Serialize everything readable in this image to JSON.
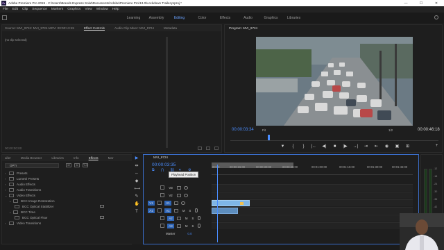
{
  "window": {
    "title": "Adobe Premiere Pro 2019 - C:\\Users\\Brands Express Solut\\Documents\\Adobe\\Premiere Pro\\13.0\\Lockdown Trailer.prproj *",
    "minimize": "—",
    "maximize": "☐",
    "close": "✕",
    "logo": "Pr"
  },
  "menu": [
    "File",
    "Edit",
    "Clip",
    "Sequence",
    "Markers",
    "Graphics",
    "View",
    "Window",
    "Help"
  ],
  "workspaces": {
    "tabs": [
      "Learning",
      "Assembly",
      "Editing",
      "Color",
      "Effects",
      "Audio",
      "Graphics",
      "Libraries"
    ],
    "active": "Editing"
  },
  "source_panel": {
    "tabs": [
      "Source: MVI_9724: MVI_9724.MOV: 00:00:13:45",
      "Effect Controls",
      "Audio Clip Mixer: MVI_9724",
      "Metadata"
    ],
    "active_tab": "Effect Controls",
    "no_clip": "(no clip selected)",
    "timecode": "00:00:00:00"
  },
  "program_monitor": {
    "title": "Program: MVI_9724",
    "timecode_current": "00:00:03:34",
    "fit": "Fit",
    "resolution": "1/2",
    "timecode_duration": "00:00:46:18",
    "transport": [
      "▼",
      "{",
      "}",
      "|←",
      "◀|",
      "■",
      "|▶",
      "→|",
      "⇥",
      "⇤",
      "◉",
      "▣",
      "⊞"
    ],
    "add": "+"
  },
  "project_panel": {
    "tabs": [
      "aller",
      "Media Browser",
      "Libraries",
      "Info",
      "Effects",
      "Mar"
    ],
    "active_tab": "Effects",
    "search_value": "OPTI",
    "tools": [
      "32",
      "32",
      "YUV"
    ],
    "tree": [
      {
        "label": "Presets",
        "indent": 0
      },
      {
        "label": "Lumetri Presets",
        "indent": 0
      },
      {
        "label": "Audio Effects",
        "indent": 0
      },
      {
        "label": "Audio Transitions",
        "indent": 0
      },
      {
        "label": "Video Effects",
        "indent": 0,
        "open": true
      },
      {
        "label": "BCC Image Restoration",
        "indent": 1,
        "open": true
      },
      {
        "label": "BCC Optical Stabilizer",
        "indent": 2,
        "effect": true
      },
      {
        "label": "BCC Time",
        "indent": 1,
        "open": true
      },
      {
        "label": "BCC Optical Flow",
        "indent": 2,
        "effect": true
      },
      {
        "label": "Video Transitions",
        "indent": 0
      }
    ]
  },
  "tools": [
    "▶",
    "⇹",
    "⇔",
    "◆",
    "⟷",
    "✎",
    "✋",
    "T"
  ],
  "timeline": {
    "title": "MVI_9724",
    "timecode": "00:00:03:35",
    "tooltip": "Playhead Position",
    "ruler_labels": [
      "00:00",
      "00:00:15:00",
      "00:00:30:00",
      "00:00:45:00",
      "00:01:00:00",
      "00:01:15:00",
      "00:01:30:00",
      "00:01:45:00"
    ],
    "tracks": [
      {
        "name": "V3",
        "type": "video",
        "target": "V3"
      },
      {
        "name": "V2",
        "type": "video",
        "target": "V2"
      },
      {
        "name": "V1",
        "type": "video",
        "target": "V1",
        "source": "V1"
      },
      {
        "name": "A1",
        "type": "audio",
        "target": "A1",
        "source": "A1"
      },
      {
        "name": "A2",
        "type": "audio",
        "target": "A2"
      },
      {
        "name": "A3",
        "type": "audio",
        "target": "A3"
      }
    ],
    "master_label": "Master",
    "master_value": "0.0",
    "m_label": "M",
    "s_label": "S"
  },
  "meter": {
    "scale": [
      "-12",
      "-18",
      "-24",
      "-30",
      "-36",
      "-42",
      "-48",
      "-54",
      "dB"
    ]
  }
}
